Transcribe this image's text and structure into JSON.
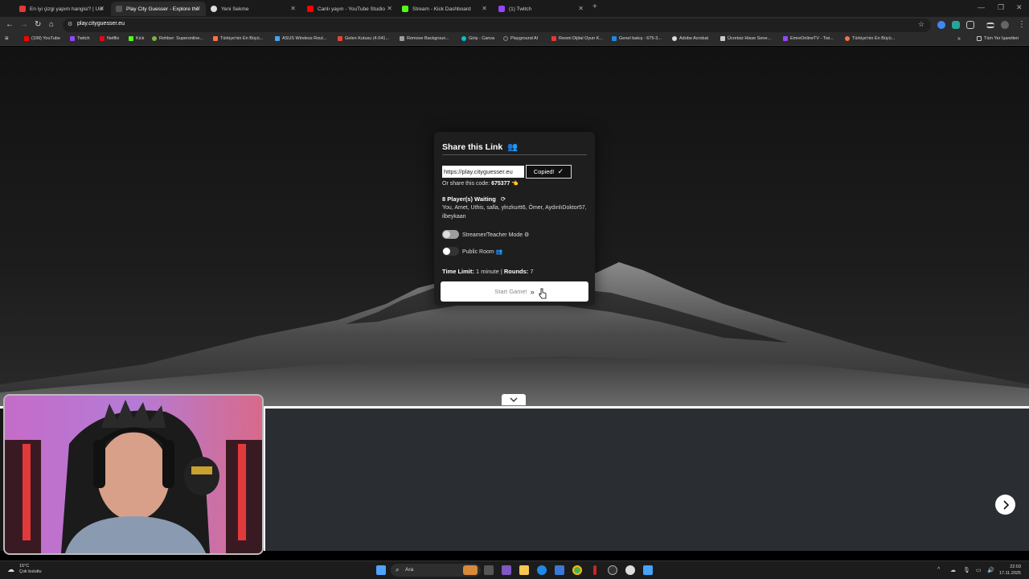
{
  "browser": {
    "tabs": [
      {
        "title": "En iyi çizgi yapım hangisi? | Uw",
        "color": "#e53935",
        "active": false
      },
      {
        "title": "Play City Guesser - Explore the",
        "color": "#222222",
        "active": true
      },
      {
        "title": "Yeni Sekme",
        "color": "#4caf50",
        "active": false
      },
      {
        "title": "Canlı yayın - YouTube Studio",
        "color": "#ff0000",
        "active": false
      },
      {
        "title": "Stream - Kick Dashboard",
        "color": "#53fc18",
        "active": false
      },
      {
        "title": "(1) Twitch",
        "color": "#9146ff",
        "active": false
      }
    ],
    "new_tab": "+",
    "url": "play.cityguesser.eu",
    "bookmarks": [
      {
        "label": "(199) YouTube",
        "color": "#ff0000"
      },
      {
        "label": "Twitch",
        "color": "#9146ff"
      },
      {
        "label": "Netflix",
        "color": "#e50914"
      },
      {
        "label": "Kick",
        "color": "#53fc18"
      },
      {
        "label": "Rehber: Superonline...",
        "color": "#7cb342"
      },
      {
        "label": "Türkiye'nin En Büyü...",
        "color": "#ff7043"
      },
      {
        "label": "ASUS Wireless Rout...",
        "color": "#42a5f5"
      },
      {
        "label": "Gelen Kutusu (4.041...",
        "color": "#ea4335"
      },
      {
        "label": "Remove Backgroun...",
        "color": "#9e9e9e"
      },
      {
        "label": "Giriş - Canva",
        "color": "#00c4cc"
      },
      {
        "label": "Playground AI",
        "color": "#333333"
      },
      {
        "label": "Resmi Dijital Oyun K...",
        "color": "#e53935"
      },
      {
        "label": "Genel bakış - 675-3...",
        "color": "#1e88e5"
      },
      {
        "label": "Adobe Acrobat",
        "color": "#dddddd"
      },
      {
        "label": "Ücretsiz Hisse Sene...",
        "color": "#cccccc"
      },
      {
        "label": "EmreOnlineTV - Twi...",
        "color": "#9146ff"
      },
      {
        "label": "Türkiye'nin En Büyü...",
        "color": "#ff7043"
      }
    ],
    "bookmarks_more": "»",
    "all_bookmarks": "Tüm Yer İşaretleri"
  },
  "modal": {
    "title": "Share this Link",
    "link_value": "https://play.cityguesser.eu",
    "copied_label": "Copied!",
    "share_code_prefix": "Or share this code:",
    "share_code": "675377",
    "waiting_label": "8 Player(s) Waiting",
    "players": "You, Amet, Uthis, salla, ylnzkurtt6, Ömer, AydınlıDoktor57, ilbeykaan",
    "streamer_mode_label": "Streamer/Teacher Mode",
    "streamer_mode_on": true,
    "public_room_label": "Public Room",
    "public_room_on": false,
    "time_limit_label": "Time Limit:",
    "time_limit_value": "1 minute",
    "rounds_label": "Rounds:",
    "rounds_value": "7",
    "start_label": "Start Game!"
  },
  "taskbar": {
    "temperature": "15°C",
    "weather": "Çok bulutlu",
    "search_placeholder": "Ara",
    "time": "22:03",
    "date": "17.11.2025"
  }
}
